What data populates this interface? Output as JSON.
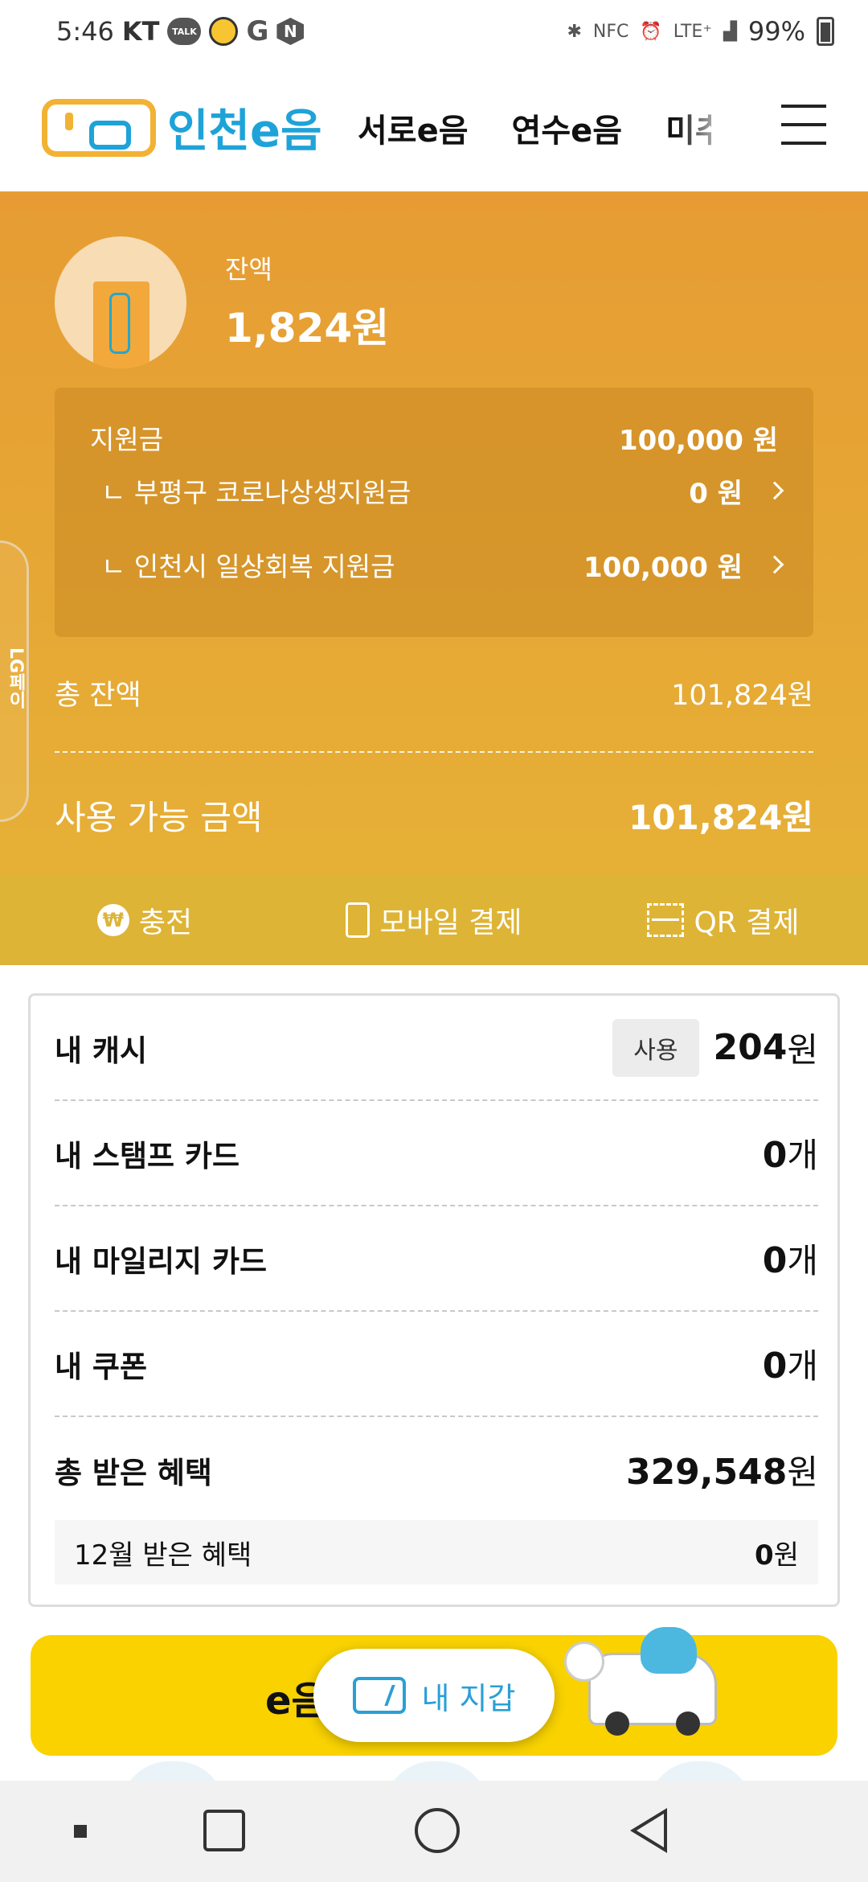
{
  "status_bar": {
    "time": "5:46",
    "carrier": "KT",
    "talk_icon": "TALK",
    "n_icon": "N",
    "g_icon": "G",
    "nfc": "NFC",
    "network": "LTE⁺",
    "battery": "99%"
  },
  "header": {
    "logo_text": "인천e음",
    "nav": [
      "서로e음",
      "연수e음",
      "미추"
    ]
  },
  "balance": {
    "label": "잔액",
    "value": "1,824원"
  },
  "support": {
    "title": "지원금",
    "total": "100,000 원",
    "items": [
      {
        "label": "ㄴ 부평구 코로나상생지원금",
        "amount": "0 원"
      },
      {
        "label": "ㄴ 인천시 일상회복 지원금",
        "amount": "100,000 원"
      }
    ]
  },
  "totals": {
    "total_label": "총 잔액",
    "total_value": "101,824원",
    "available_label": "사용 가능 금액",
    "available_value": "101,824원"
  },
  "actions": {
    "charge": "충전",
    "charge_icon": "₩",
    "mobile_pay": "모바일 결제",
    "qr_pay": "QR 결제"
  },
  "benefits": {
    "cash_label": "내 캐시",
    "cash_use_button": "사용",
    "cash_value": "204",
    "cash_unit": "원",
    "stamp_label": "내 스탬프 카드",
    "stamp_value": "0",
    "stamp_unit": "개",
    "mileage_label": "내 마일리지 카드",
    "mileage_value": "0",
    "mileage_unit": "개",
    "coupon_label": "내 쿠폰",
    "coupon_value": "0",
    "coupon_unit": "개",
    "total_label": "총 받은 혜택",
    "total_value": "329,548",
    "total_unit": "원",
    "month_label": "12월 받은 혜택",
    "month_value": "0",
    "month_unit": "원"
  },
  "banner": {
    "text": "e음"
  },
  "wallet_button": "내 지갑",
  "side_tab": "LG페이",
  "colors": {
    "panel_top": "#e69c33",
    "panel_bottom": "#e6b036",
    "action_bar": "#deb436",
    "banner": "#f9d200",
    "accent_blue": "#2a9fd6"
  }
}
